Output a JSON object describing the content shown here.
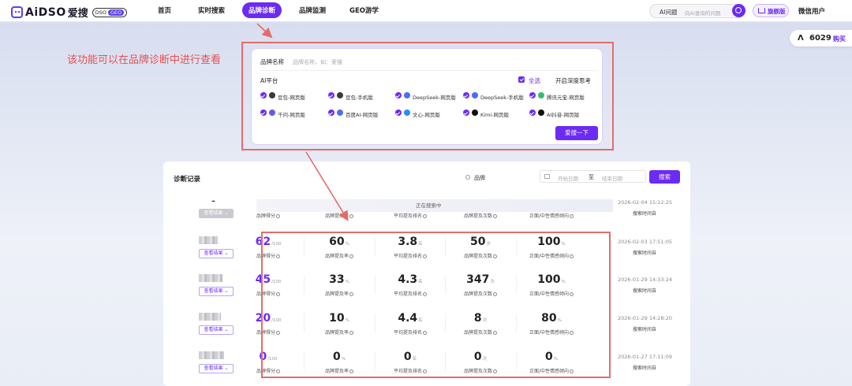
{
  "nav": {
    "logo_text": "AiDSO",
    "logo_zh": "爱搜",
    "badge_dso": "DSO",
    "badge_geo": "GEO",
    "items": [
      "首页",
      "实时搜索",
      "品牌诊断",
      "品牌监测",
      "GEO游学"
    ],
    "active_index": 2,
    "search_label": "AI问题",
    "search_placeholder": "向AI查询的问题",
    "vip_label": "旗舰版",
    "user_label": "微信用户"
  },
  "credit": {
    "value": "6029",
    "buy": "购买"
  },
  "annotation": "该功能可以在品牌诊断中进行查看",
  "panel": {
    "brand_label": "品牌名称",
    "brand_placeholder": "品牌名称，如：爱搜",
    "platform_label": "AI平台",
    "select_all": "全选",
    "deep_think": "开启深度思考",
    "platforms": [
      {
        "name": "豆包-网页版",
        "color": "#3a3a3a"
      },
      {
        "name": "豆包-手机版",
        "color": "#3a3a3a"
      },
      {
        "name": "DeepSeek-网页版",
        "color": "#4d6bfe"
      },
      {
        "name": "DeepSeek-手机版",
        "color": "#4d6bfe"
      },
      {
        "name": "腾讯元宝-网页版",
        "color": "#2fbf71"
      },
      {
        "name": "千问-网页版",
        "color": "#615ced"
      },
      {
        "name": "百度AI-网页版",
        "color": "#4e6ef2"
      },
      {
        "name": "文心-网页版",
        "color": "#2a8cf0"
      },
      {
        "name": "Kimi-网页版",
        "color": "#111111"
      },
      {
        "name": "AI抖音-网页版",
        "color": "#111111"
      }
    ],
    "submit": "爱搜一下"
  },
  "records": {
    "title": "诊断记录",
    "search_value": "品牌",
    "start_placeholder": "开始日期",
    "to": "至",
    "end_placeholder": "结束日期",
    "search_btn": "搜索",
    "searching_text": "正在搜索中",
    "view_label": "查看结果",
    "metric_labels": [
      "品牌得分",
      "品牌提及率",
      "平均提及排名",
      "品牌提及次数",
      "正面/中性情感倾向"
    ],
    "units": [
      "/100",
      "%",
      "名",
      "次",
      "%"
    ],
    "time_label": "搜索时间自",
    "rows": [
      {
        "searching": true,
        "time": "2026-02-04 15:12:25"
      },
      {
        "values": [
          "62",
          "60",
          "3.8",
          "50",
          "100"
        ],
        "time": "2026-02-03 17:51:05"
      },
      {
        "values": [
          "45",
          "33",
          "4.3",
          "347",
          "100"
        ],
        "time": "2026-01-29 14:33:24"
      },
      {
        "values": [
          "20",
          "10",
          "4.4",
          "8",
          "80"
        ],
        "time": "2026-01-29 14:28:20"
      },
      {
        "values": [
          "0",
          "0",
          "0",
          "0",
          "0"
        ],
        "time": "2026-01-27 17:11:09"
      }
    ]
  }
}
